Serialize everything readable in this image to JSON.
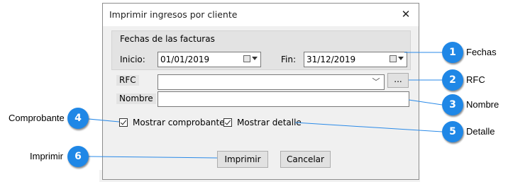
{
  "dialog": {
    "title": "Imprimir ingresos por cliente",
    "group_title": "Fechas de las facturas",
    "start_label": "Inicio:",
    "start_value": "01/01/2019",
    "end_label": "Fin:",
    "end_value": "31/12/2019",
    "rfc_label": "RFC",
    "rfc_value": "",
    "browse_label": "...",
    "name_label": "Nombre",
    "name_value": "",
    "show_voucher_label": "Mostrar comprobante",
    "show_voucher_checked": true,
    "show_detail_label": "Mostrar detalle",
    "show_detail_checked": true,
    "print_button": "Imprimir",
    "cancel_button": "Cancelar"
  },
  "background": {
    "row_text_left": "...",
    "row_text_mid": "...",
    "row_text_right": "..."
  },
  "annotations": [
    {
      "number": "1",
      "label": "Fechas"
    },
    {
      "number": "2",
      "label": "RFC"
    },
    {
      "number": "3",
      "label": "Nombre"
    },
    {
      "number": "4",
      "label": "Comprobante"
    },
    {
      "number": "5",
      "label": "Detalle"
    },
    {
      "number": "6",
      "label": "Imprimir"
    }
  ],
  "colors": {
    "badge": "#1f87e6",
    "callout_line": "#2a8ae8",
    "dialog_bg": "#f0f0f0"
  }
}
